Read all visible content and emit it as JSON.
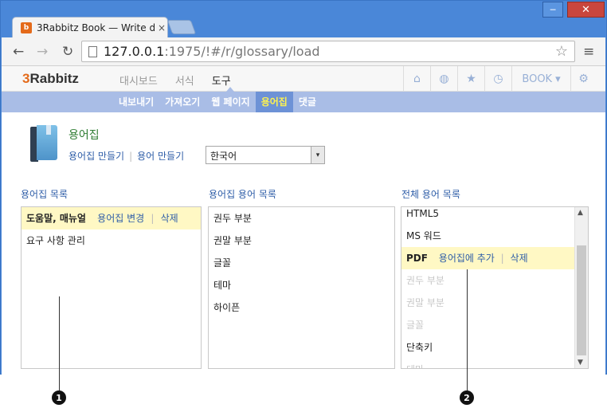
{
  "browser": {
    "tab_title": "3Rabbitz Book — Write d",
    "tab_close": "×",
    "url_host": "127.0.0.1",
    "url_path": ":1975/!#/r/glossary/load",
    "win_min": "─",
    "win_max": "☐",
    "win_close": "✕",
    "back_icon": "←",
    "forward_icon": "→",
    "reload_icon": "↻",
    "star_icon": "☆",
    "menu_icon": "≡",
    "favicon": "b"
  },
  "app": {
    "logo_prefix": "3",
    "logo_rest": "Rabbitz",
    "main_nav": [
      "대시보드",
      "서식",
      "도구"
    ],
    "active_main_nav": "도구",
    "header_icons": {
      "home": "⌂",
      "globe": "◍",
      "star": "★",
      "clock": "◷",
      "book_label": "BOOK",
      "book_caret": "▾",
      "gear": "⚙"
    },
    "sub_nav": [
      "내보내기",
      "가져오기",
      "웹 페이지",
      "용어집",
      "댓글"
    ],
    "active_sub_nav": "용어집"
  },
  "glossary": {
    "title": "용어집",
    "create_glossary": "용어집 만들기",
    "create_term": "용어 만들기",
    "separator": "|",
    "language": "한국어",
    "select_arrow": "▾"
  },
  "columns": {
    "glossary_list": {
      "heading": "용어집 목록",
      "items": [
        {
          "label": "도움말, 매뉴얼",
          "selected": true,
          "edit": "용어집 변경",
          "delete": "삭제"
        },
        {
          "label": "요구 사항 관리",
          "selected": false
        }
      ]
    },
    "glossary_terms": {
      "heading": "용어집 용어 목록",
      "items": [
        "권두 부분",
        "권말 부분",
        "글꼴",
        "테마",
        "하이픈"
      ]
    },
    "all_terms": {
      "heading": "전체 용어 목록",
      "items": [
        {
          "label": "HTML5",
          "state": "normal"
        },
        {
          "label": "MS 워드",
          "state": "normal"
        },
        {
          "label": "PDF",
          "state": "selected",
          "add": "용어집에 추가",
          "delete": "삭제"
        },
        {
          "label": "권두 부분",
          "state": "dim"
        },
        {
          "label": "권말 부분",
          "state": "dim"
        },
        {
          "label": "글꼴",
          "state": "dim"
        },
        {
          "label": "단축키",
          "state": "normal"
        },
        {
          "label": "테마",
          "state": "dim"
        }
      ],
      "scroll_up": "▲",
      "scroll_down": "▼"
    }
  },
  "callouts": [
    "1",
    "2"
  ],
  "colors": {
    "accent_blue": "#2f5ea8",
    "subnav_bg": "#a9bde6",
    "subnav_active": "#6d92d6",
    "highlight_row": "#fff8c4",
    "title_green": "#2e7d32",
    "window_frame": "#4a87d8"
  }
}
